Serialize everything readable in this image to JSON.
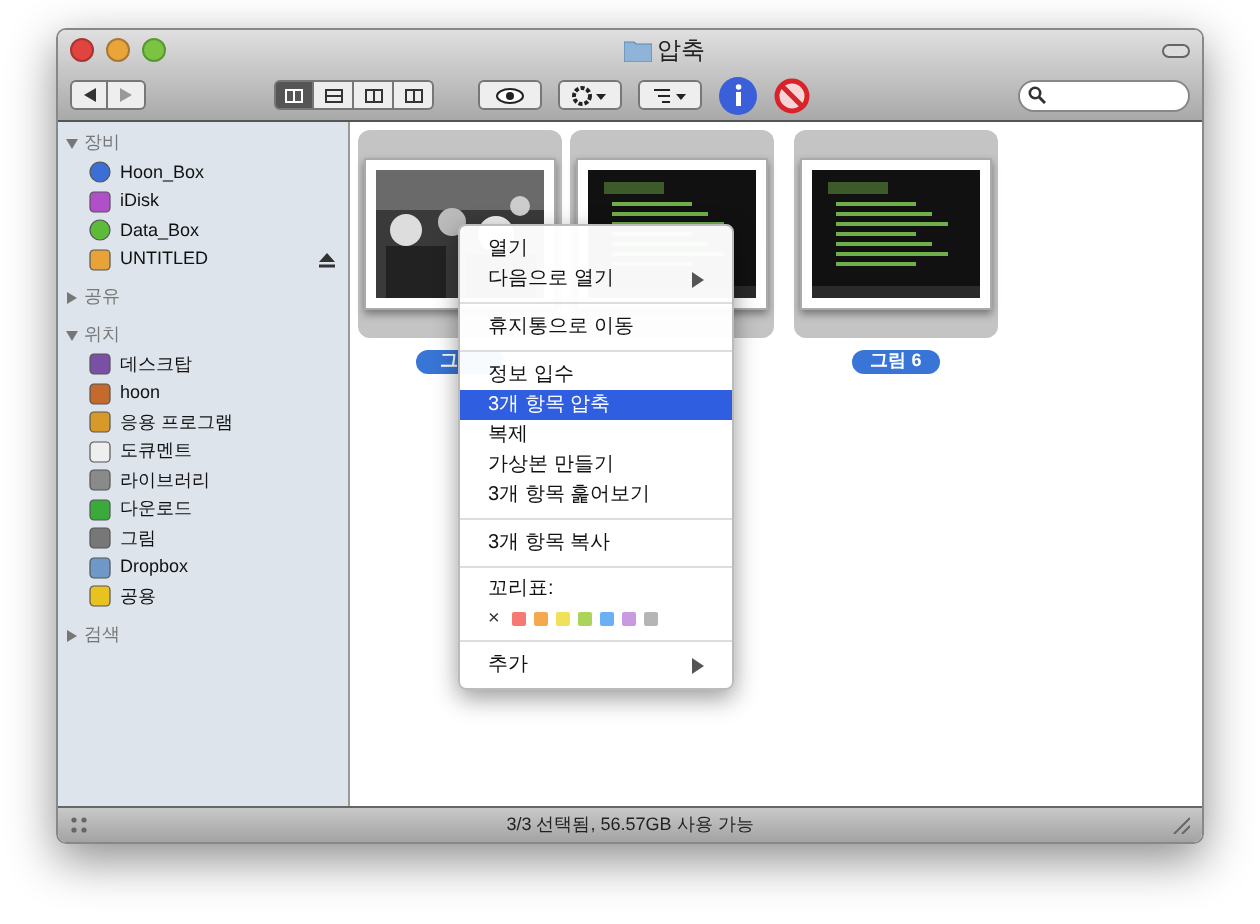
{
  "window": {
    "title": "압축"
  },
  "toolbar": {
    "view_modes": [
      {
        "selected": true
      },
      {
        "selected": false
      },
      {
        "selected": false
      },
      {
        "selected": false
      }
    ]
  },
  "sidebar": {
    "sections": [
      {
        "title": "장비",
        "expanded": true,
        "items": [
          {
            "label": "Hoon_Box",
            "eject": false
          },
          {
            "label": "iDisk",
            "eject": false
          },
          {
            "label": "Data_Box",
            "eject": false
          },
          {
            "label": "UNTITLED",
            "eject": true
          }
        ]
      },
      {
        "title": "공유",
        "expanded": false
      },
      {
        "title": "위치",
        "expanded": true,
        "items": [
          {
            "label": "데스크탑",
            "eject": false
          },
          {
            "label": "hoon",
            "eject": false
          },
          {
            "label": "응용 프로그램",
            "eject": false
          },
          {
            "label": "도큐멘트",
            "eject": false
          },
          {
            "label": "라이브러리",
            "eject": false
          },
          {
            "label": "다운로드",
            "eject": false
          },
          {
            "label": "그림",
            "eject": false
          },
          {
            "label": "Dropbox",
            "eject": false
          },
          {
            "label": "공용",
            "eject": false
          }
        ]
      },
      {
        "title": "검색",
        "expanded": false
      }
    ]
  },
  "files": [
    {
      "label": "그",
      "selected": true
    },
    {
      "selected": true
    },
    {
      "label": "그림 6",
      "selected": true
    }
  ],
  "context_menu": {
    "items": [
      {
        "kind": "item",
        "label": "열기",
        "selected": false
      },
      {
        "kind": "submenu",
        "label": "다음으로 열기",
        "selected": false
      },
      {
        "kind": "separator"
      },
      {
        "kind": "item",
        "label": "휴지통으로 이동",
        "selected": false
      },
      {
        "kind": "separator"
      },
      {
        "kind": "item",
        "label": "정보 입수",
        "selected": false
      },
      {
        "kind": "item",
        "label": "3개 항목 압축",
        "selected": true
      },
      {
        "kind": "item",
        "label": "복제",
        "selected": false
      },
      {
        "kind": "item",
        "label": "가상본 만들기",
        "selected": false
      },
      {
        "kind": "item",
        "label": "3개 항목 훑어보기",
        "selected": false
      },
      {
        "kind": "separator"
      },
      {
        "kind": "item",
        "label": "3개 항목 복사",
        "selected": false
      },
      {
        "kind": "separator"
      },
      {
        "kind": "label",
        "label": "꼬리표:"
      },
      {
        "kind": "tags",
        "clear": "×",
        "tags": [
          {
            "color": "#f47a72"
          },
          {
            "color": "#f5a94f"
          },
          {
            "color": "#f1e15a"
          },
          {
            "color": "#aad45a"
          },
          {
            "color": "#6ab0f5"
          },
          {
            "color": "#c99ae0"
          },
          {
            "color": "#b5b5b5"
          }
        ]
      },
      {
        "kind": "separator"
      },
      {
        "kind": "submenu",
        "label": "추가",
        "selected": false
      }
    ]
  },
  "status_bar": {
    "text": "3/3 선택됨, 56.57GB 사용 가능"
  }
}
